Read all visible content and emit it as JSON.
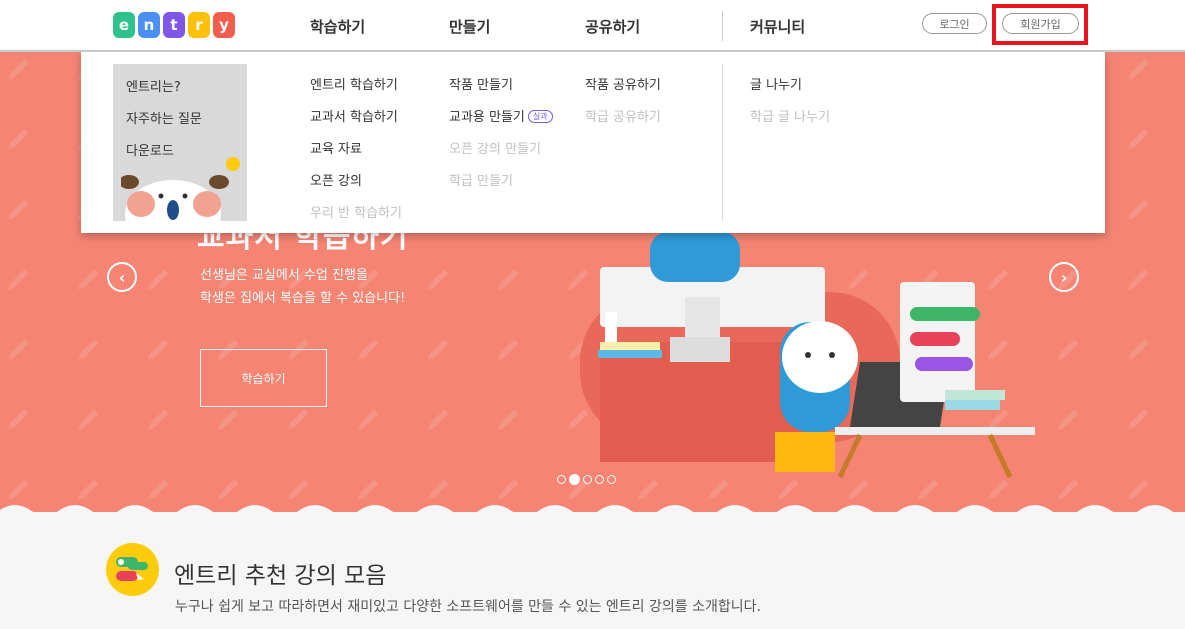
{
  "logo": {
    "letters": [
      "e",
      "n",
      "t",
      "r",
      "y"
    ],
    "colors": [
      "#2fc28a",
      "#4a8ef6",
      "#7e56e8",
      "#fec10b",
      "#f35d4e"
    ]
  },
  "nav": {
    "learn": "학습하기",
    "make": "만들기",
    "share": "공유하기",
    "community": "커뮤니티",
    "login": "로그인",
    "signup": "회원가입"
  },
  "dropdown": {
    "side": [
      "엔트리는?",
      "자주하는 질문",
      "다운로드"
    ],
    "learn": [
      {
        "label": "엔트리 학습하기",
        "disabled": false
      },
      {
        "label": "교과서 학습하기",
        "disabled": false
      },
      {
        "label": "교육 자료",
        "disabled": false
      },
      {
        "label": "오픈 강의",
        "disabled": false
      },
      {
        "label": "우리 반 학습하기",
        "disabled": true
      }
    ],
    "make": [
      {
        "label": "작품 만들기",
        "disabled": false
      },
      {
        "label": "교과용 만들기",
        "disabled": false
      },
      {
        "label": "오픈 강의 만들기",
        "disabled": true
      },
      {
        "label": "학급 만들기",
        "disabled": true
      }
    ],
    "make_badge": "실과",
    "share": [
      {
        "label": "작품 공유하기",
        "disabled": false
      },
      {
        "label": "학급 공유하기",
        "disabled": true
      }
    ],
    "community": [
      {
        "label": "글 나누기",
        "disabled": false
      },
      {
        "label": "학급 글 나누기",
        "disabled": true
      }
    ]
  },
  "hero": {
    "title": "교과서 학습하기",
    "desc_line1": "선생님은 교실에서 수업 진행을",
    "desc_line2": "학생은 집에서 복습을 할 수 있습니다!",
    "button": "학습하기",
    "prev": "‹",
    "next": "›",
    "slide_count": 5,
    "active_slide": 2,
    "bg_color": "#f58473"
  },
  "section": {
    "title": "엔트리 추천 강의 모음",
    "subtitle": "누구나 쉽게 보고 따라하면서 재미있고 다양한 소프트웨어를 만들 수 있는 엔트리 강의를 소개합니다."
  },
  "accent": {
    "highlight": "#e8141c"
  }
}
